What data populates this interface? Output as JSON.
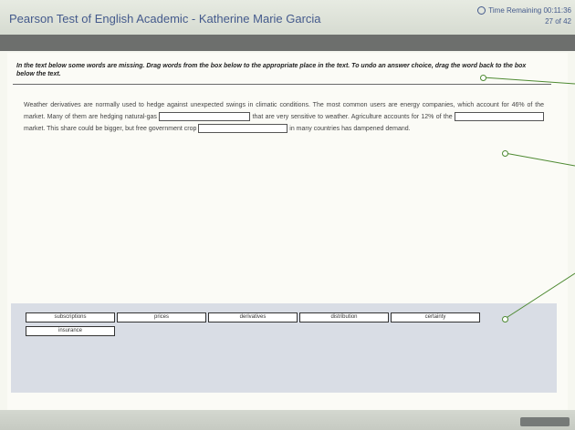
{
  "window": {
    "title": "Pearson Test of English Academic - Katherine Marie Garcia"
  },
  "timer": {
    "label": "Time Remaining 00:11:36",
    "progress": "27 of 42"
  },
  "task": {
    "instructions": "In the text below some words are missing. Drag words from the box below to the appropriate place in the text. To undo an answer choice, drag the word back to the box below the text."
  },
  "passage": {
    "part1": "Weather derivatives are normally used to hedge against unexpected swings in climatic conditions. The most common users are energy companies, which account for 46% of the market. Many of them are hedging natural-gas",
    "part2": "that are very sensitive to weather. Agriculture accounts for 12% of the",
    "part3": "market. This share could be bigger, but free government crop",
    "part4": "in many countries has dampened demand."
  },
  "word_bank": {
    "words": [
      "subscriptions",
      "prices",
      "derivatives",
      "distribution",
      "certainty",
      "insurance"
    ]
  }
}
